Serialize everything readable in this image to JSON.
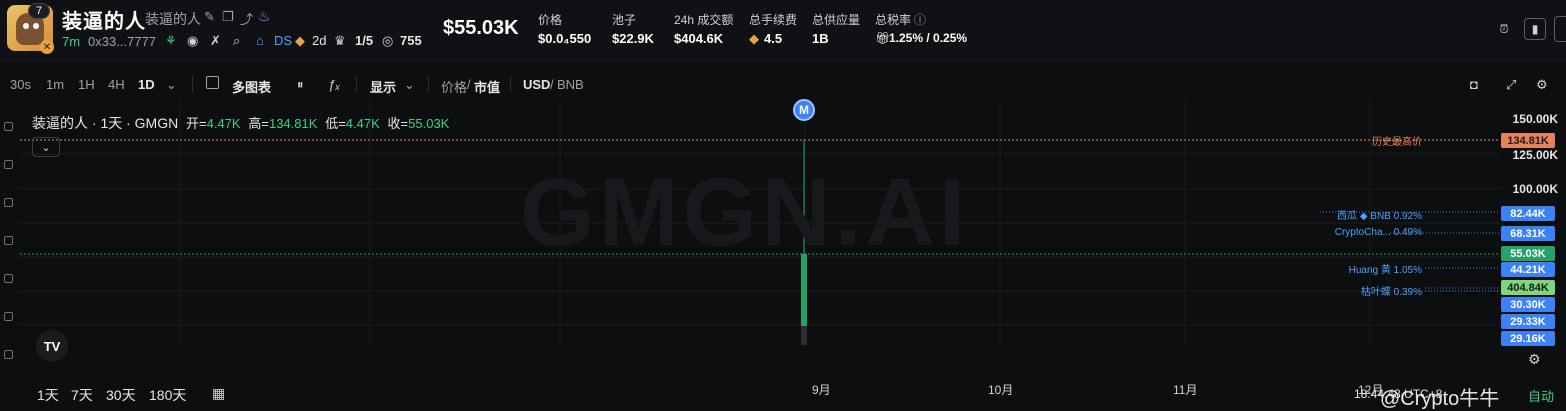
{
  "token": {
    "name": "装逼的人",
    "subtitle": "装逼的人",
    "age": "7m",
    "address": "0x33...7777",
    "badge_count": "7",
    "chain_tag": "DS",
    "duration": "2d",
    "holders_ratio": "1/5",
    "views": "755",
    "price": "$55.03K"
  },
  "stats": [
    {
      "label": "价格",
      "value": "$0.0₄550"
    },
    {
      "label": "池子",
      "value": "$22.9K"
    },
    {
      "label": "24h 成交额",
      "value": "$404.6K"
    },
    {
      "label": "总手续费",
      "value": "4.5"
    },
    {
      "label": "总供应量",
      "value": "1B"
    },
    {
      "label": "总税率",
      "value": "1.25% / 0.25%"
    }
  ],
  "toolbar": {
    "intervals": [
      "30s",
      "1m",
      "1H",
      "4H",
      "1D"
    ],
    "active_interval": "1D",
    "multi_chart": "多图表",
    "display": "显示",
    "price_label": "价格",
    "mcap_label": "市值",
    "usd": "USD",
    "bnb": "BNB"
  },
  "legend": {
    "title": "装逼的人 · 1天 · GMGN",
    "open_k": "开=",
    "open_v": "4.47K",
    "high_k": "高=",
    "high_v": "134.81K",
    "low_k": "低=",
    "low_v": "4.47K",
    "close_k": "收=",
    "close_v": "55.03K"
  },
  "watermark": "GMGN.AI",
  "marker": "M",
  "yaxis": [
    "150.00K",
    "125.00K",
    "100.00K"
  ],
  "tags": [
    {
      "text": "134.81K",
      "color": "#e8825a",
      "fg": "#1b1b1b"
    },
    {
      "text": "82.44K",
      "color": "#3b82f6",
      "fg": "#ffffff"
    },
    {
      "text": "68.31K",
      "color": "#3b82f6",
      "fg": "#ffffff"
    },
    {
      "text": "55.03K",
      "color": "#26a269",
      "fg": "#ffffff"
    },
    {
      "text": "44.21K",
      "color": "#3b82f6",
      "fg": "#ffffff"
    },
    {
      "text": "404.84K",
      "color": "#7ed67e",
      "fg": "#1b1b1b"
    },
    {
      "text": "30.30K",
      "color": "#3b82f6",
      "fg": "#ffffff"
    },
    {
      "text": "29.33K",
      "color": "#3b82f6",
      "fg": "#ffffff"
    },
    {
      "text": "29.16K",
      "color": "#3b82f6",
      "fg": "#ffffff"
    }
  ],
  "annotations": {
    "ath": "历史最高价",
    "a1": "西瓜 ◆ BNB 0.92%",
    "a2": "CryptoCha... 0.49%",
    "a3": "Huang 黄 1.05%",
    "a4": "枯叶蝶 0.39%"
  },
  "xaxis": [
    "9月",
    "10月",
    "11月",
    "12月"
  ],
  "ranges": [
    "1天",
    "7天",
    "30天",
    "180天"
  ],
  "clock": "18:44:48 UTC+8",
  "overlay_watermark": "@Crypto牛牛",
  "auto": "自动"
}
